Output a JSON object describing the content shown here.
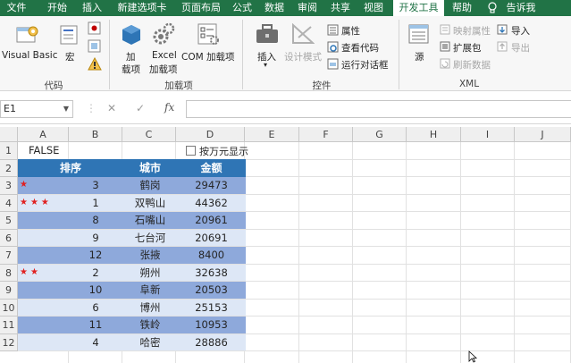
{
  "menubar": {
    "tabs": [
      "文件",
      "开始",
      "插入",
      "新建选项卡",
      "页面布局",
      "公式",
      "数据",
      "审阅",
      "共享",
      "视图",
      "开发工具",
      "帮助",
      "告诉我"
    ],
    "active": "开发工具"
  },
  "ribbon": {
    "code": {
      "visual_basic": "Visual Basic",
      "macros": "宏",
      "group": "代码"
    },
    "addins": {
      "add": "加",
      "add2": "载项",
      "excel": "Excel",
      "excel2": "加载项",
      "com": "COM 加载项",
      "group": "加载项"
    },
    "controls": {
      "insert": "插入",
      "design_mode": "设计模式",
      "properties": "属性",
      "view_code": "查看代码",
      "run_dialog": "运行对话框",
      "group": "控件"
    },
    "xml": {
      "source": "源",
      "map_props": "映射属性",
      "expansion": "扩展包",
      "refresh": "刷新数据",
      "import": "导入",
      "export": "导出",
      "group": "XML"
    }
  },
  "formula_bar": {
    "name_box": "E1",
    "cancel": "✕",
    "enter": "✓",
    "fx": "fx",
    "value": ""
  },
  "columns": [
    "A",
    "B",
    "C",
    "D",
    "E",
    "F",
    "G",
    "H",
    "I",
    "J"
  ],
  "rows": [
    "1",
    "2",
    "3",
    "4",
    "5",
    "6",
    "7",
    "8",
    "9",
    "10",
    "11",
    "12"
  ],
  "sheet": {
    "a1": "FALSE",
    "checkbox_label": "按万元显示",
    "headers": {
      "rank": "排序",
      "city": "城市",
      "amount": "金额"
    },
    "data": [
      {
        "stars": "★",
        "rank": "3",
        "city": "鹤岗",
        "amount": "29473"
      },
      {
        "stars": "★★★",
        "rank": "1",
        "city": "双鸭山",
        "amount": "44362"
      },
      {
        "stars": "",
        "rank": "8",
        "city": "石嘴山",
        "amount": "20961"
      },
      {
        "stars": "",
        "rank": "9",
        "city": "七台河",
        "amount": "20691"
      },
      {
        "stars": "",
        "rank": "12",
        "city": "张掖",
        "amount": "8400"
      },
      {
        "stars": "★★",
        "rank": "2",
        "city": "朔州",
        "amount": "32638"
      },
      {
        "stars": "",
        "rank": "10",
        "city": "阜新",
        "amount": "20503"
      },
      {
        "stars": "",
        "rank": "6",
        "city": "博州",
        "amount": "25153"
      },
      {
        "stars": "",
        "rank": "11",
        "city": "铁岭",
        "amount": "10953"
      },
      {
        "stars": "",
        "rank": "4",
        "city": "哈密",
        "amount": "28886"
      }
    ]
  },
  "colors": {
    "excel_green": "#217346",
    "header_blue": "#2f75b5",
    "row_dark": "#8ea9db",
    "row_light": "#dde7f6",
    "star_red": "#e02020"
  }
}
